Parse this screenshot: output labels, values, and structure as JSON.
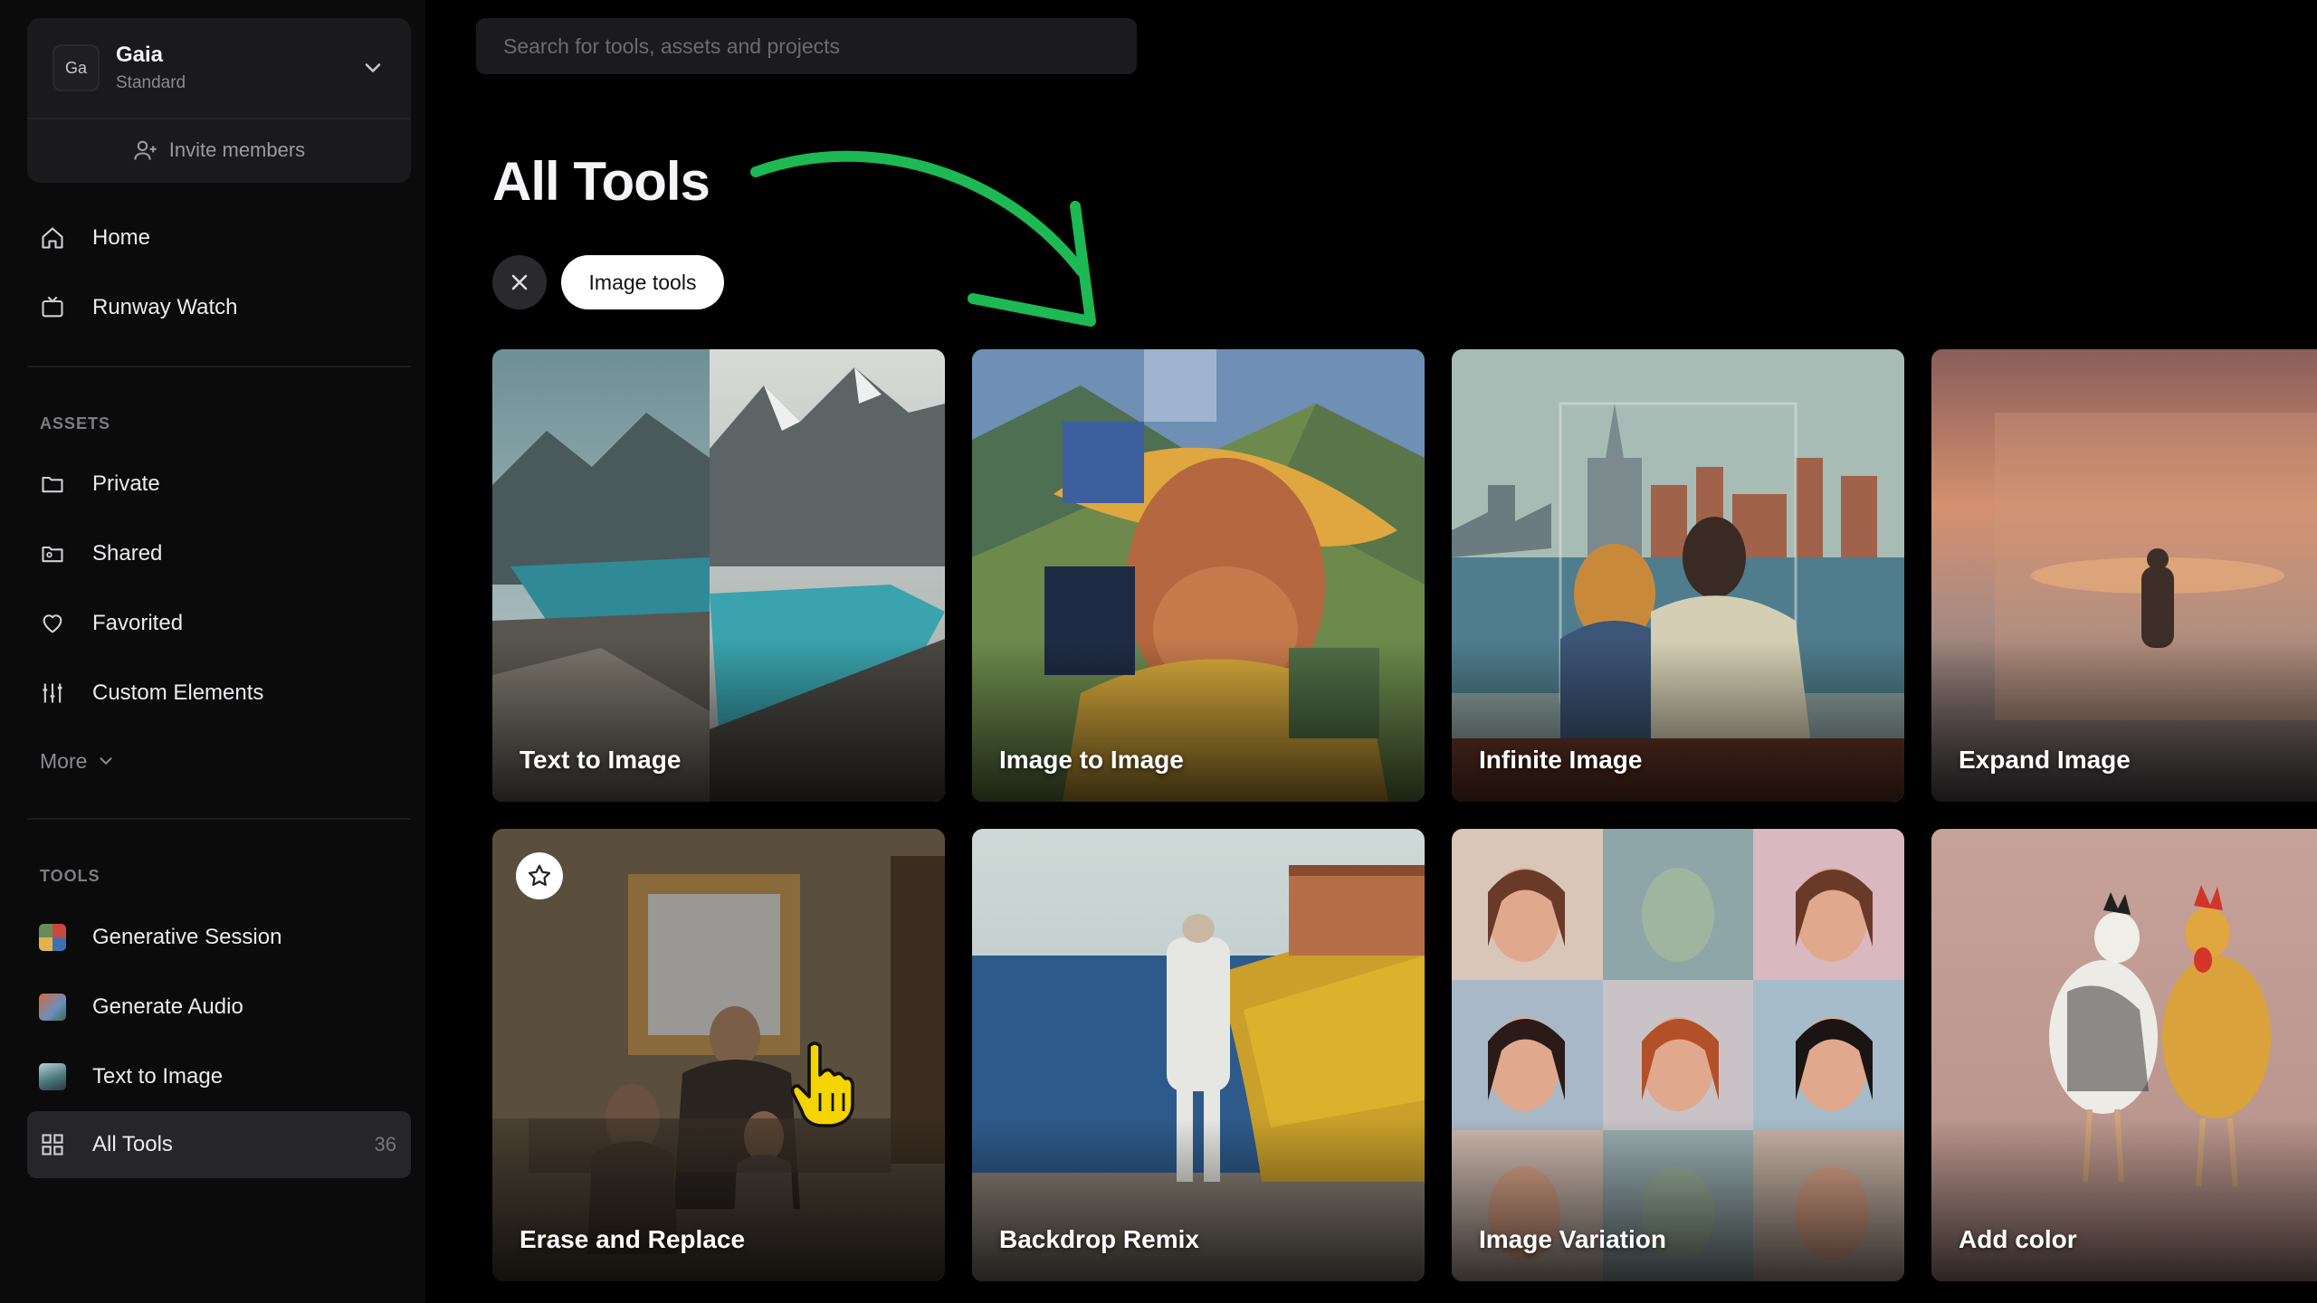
{
  "workspace": {
    "initials": "Ga",
    "name": "Gaia",
    "plan": "Standard",
    "invite_label": "Invite members"
  },
  "nav": {
    "home": "Home",
    "runway_watch": "Runway Watch"
  },
  "assets": {
    "section": "ASSETS",
    "private": "Private",
    "shared": "Shared",
    "favorited": "Favorited",
    "custom_elements": "Custom Elements",
    "more": "More"
  },
  "tools": {
    "section": "TOOLS",
    "generative_session": "Generative Session",
    "generate_audio": "Generate Audio",
    "text_to_image": "Text to Image",
    "all_tools": "All Tools",
    "all_tools_count": "36"
  },
  "search": {
    "placeholder": "Search for tools, assets and projects"
  },
  "page": {
    "title": "All Tools",
    "filter_chip": "Image tools"
  },
  "cards": [
    {
      "label": "Text to Image"
    },
    {
      "label": "Image to Image"
    },
    {
      "label": "Infinite Image"
    },
    {
      "label": "Expand Image"
    },
    {
      "label": "Erase and Replace"
    },
    {
      "label": "Backdrop Remix"
    },
    {
      "label": "Image Variation"
    },
    {
      "label": "Add color"
    }
  ],
  "colors": {
    "background": "#000000",
    "sidebar": "#0b0b0c",
    "active_item": "#25252a",
    "arrow": "#1db954",
    "cursor": "#f5d400"
  },
  "icons": [
    "chevron-down-icon",
    "add-person-icon",
    "home-icon",
    "tv-icon",
    "folder-icon",
    "shared-folder-icon",
    "heart-icon",
    "sliders-icon",
    "grid-icon",
    "close-icon",
    "star-icon",
    "hand-cursor-icon"
  ]
}
